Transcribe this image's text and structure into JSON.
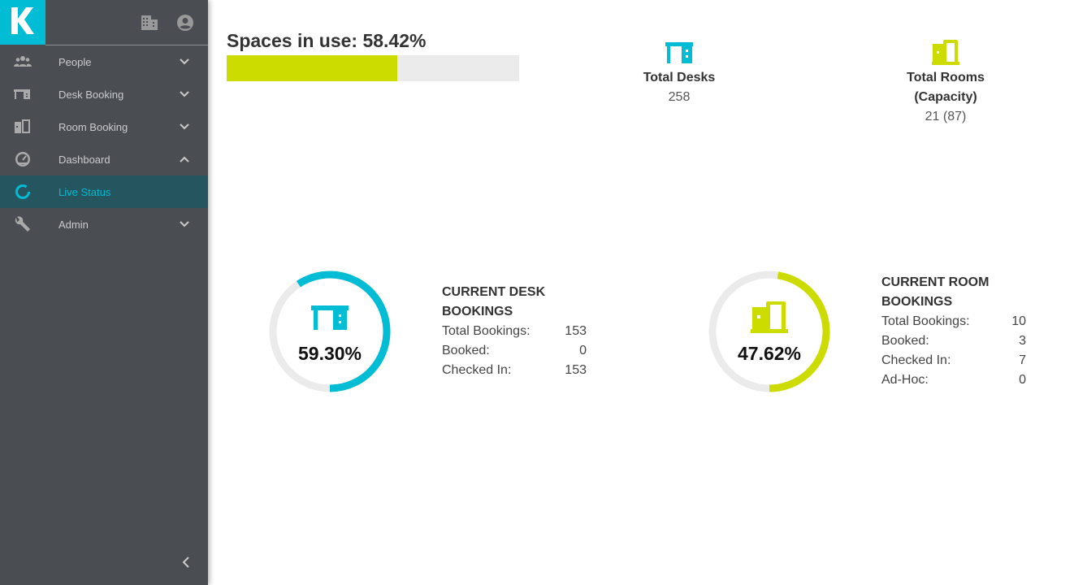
{
  "brand": {
    "logo_letter": "K",
    "accent": "#00bcd4",
    "secondary": "#cddc00"
  },
  "header": {
    "icons": [
      "building-icon",
      "account-icon"
    ]
  },
  "sidebar": {
    "items": [
      {
        "label": "People",
        "icon": "people-icon",
        "chevron": "down"
      },
      {
        "label": "Desk Booking",
        "icon": "desk-icon",
        "chevron": "down"
      },
      {
        "label": "Room Booking",
        "icon": "door-icon",
        "chevron": "down"
      },
      {
        "label": "Dashboard",
        "icon": "gauge-icon",
        "chevron": "up"
      },
      {
        "label": "Live Status",
        "icon": "ring-icon",
        "active": true
      },
      {
        "label": "Admin",
        "icon": "wrench-icon",
        "chevron": "down"
      }
    ]
  },
  "main": {
    "spaces": {
      "label": "Spaces in use: 58.42%",
      "percent": 58.42
    },
    "total_desks": {
      "label": "Total Desks",
      "value": "258"
    },
    "total_rooms": {
      "label_line1": "Total Rooms",
      "label_line2": "(Capacity)",
      "value": "21 (87)"
    },
    "desk": {
      "percent_label": "59.30%",
      "percent": 59.3,
      "title_line1": "CURRENT DESK",
      "title_line2": "BOOKINGS",
      "rows": [
        {
          "label": "Total Bookings:",
          "value": "153"
        },
        {
          "label": "Booked:",
          "value": "0"
        },
        {
          "label": "Checked In:",
          "value": "153"
        }
      ]
    },
    "room": {
      "percent_label": "47.62%",
      "percent": 47.62,
      "title_line1": "CURRENT ROOM",
      "title_line2": "BOOKINGS",
      "rows": [
        {
          "label": "Total Bookings:",
          "value": "10"
        },
        {
          "label": "Booked:",
          "value": "3"
        },
        {
          "label": "Checked In:",
          "value": "7"
        },
        {
          "label": "Ad-Hoc:",
          "value": "0"
        }
      ]
    }
  }
}
